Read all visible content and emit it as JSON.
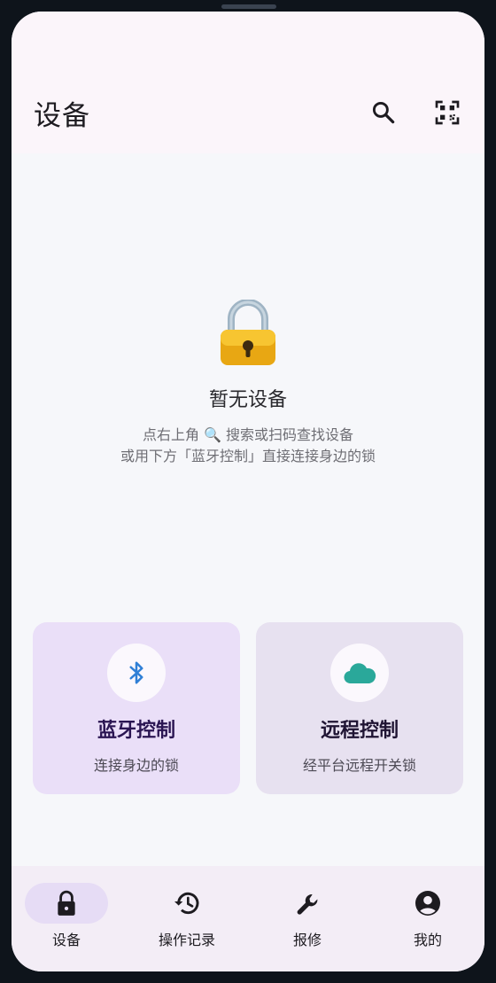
{
  "appbar": {
    "title": "设备",
    "search_icon": "search-icon",
    "scan_icon": "qr-scan-icon"
  },
  "empty_state": {
    "icon": "lock-emoji",
    "title": "暂无设备",
    "hint_line1": "点右上角 🔍 搜索或扫码查找设备",
    "hint_line2": "或用下方「蓝牙控制」直接连接身边的锁"
  },
  "cards": {
    "bluetooth": {
      "icon": "bluetooth-icon",
      "title": "蓝牙控制",
      "subtitle": "连接身边的锁",
      "color": "#eadff8"
    },
    "remote": {
      "icon": "cloud-icon",
      "title": "远程控制",
      "subtitle": "经平台远程开关锁",
      "color": "#e7e1f0"
    }
  },
  "bottom_nav": {
    "items": [
      {
        "label": "设备",
        "icon": "lock-icon",
        "selected": true
      },
      {
        "label": "操作记录",
        "icon": "history-icon",
        "selected": false
      },
      {
        "label": "报修",
        "icon": "wrench-icon",
        "selected": false
      },
      {
        "label": "我的",
        "icon": "account-circle-icon",
        "selected": false
      }
    ]
  },
  "colors": {
    "appbar_bg": "#fbf5fa",
    "screen_bg": "#f6f7fa",
    "nav_bg": "#f3edf6",
    "nav_indicator": "#e6dcf5",
    "bluetooth_blue": "#2f7fd6",
    "cloud_teal": "#2aa89a"
  }
}
